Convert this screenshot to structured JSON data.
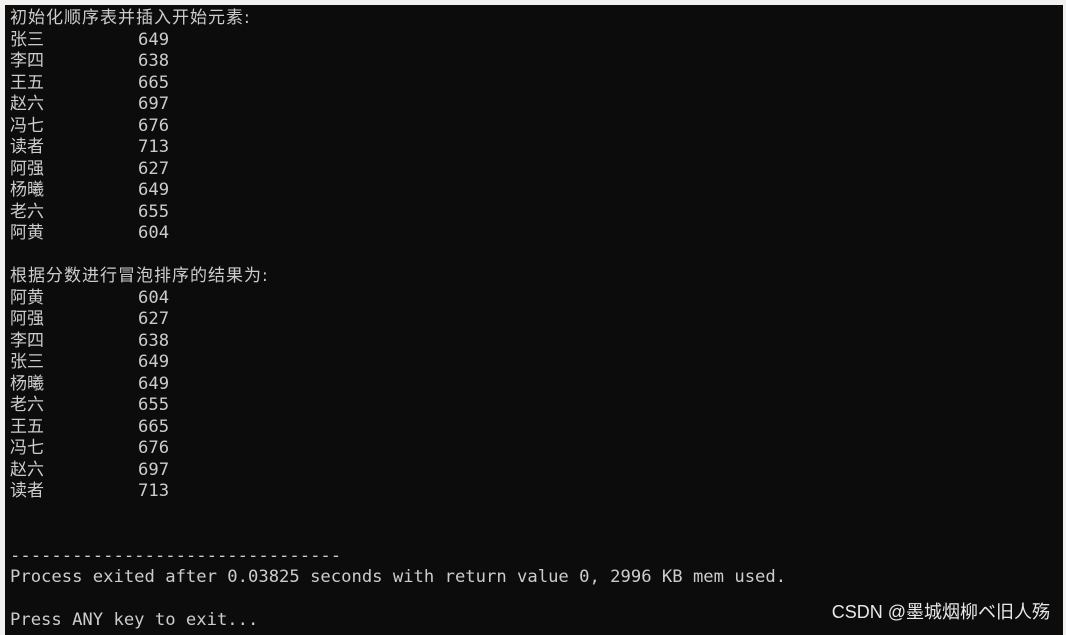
{
  "console": {
    "heading_initial": "初始化顺序表并插入开始元素:",
    "initial_rows": [
      {
        "name": "张三",
        "score": "649"
      },
      {
        "name": "李四",
        "score": "638"
      },
      {
        "name": "王五",
        "score": "665"
      },
      {
        "name": "赵六",
        "score": "697"
      },
      {
        "name": "冯七",
        "score": "676"
      },
      {
        "name": "读者",
        "score": "713"
      },
      {
        "name": "阿强",
        "score": "627"
      },
      {
        "name": "杨曦",
        "score": "649"
      },
      {
        "name": "老六",
        "score": "655"
      },
      {
        "name": "阿黄",
        "score": "604"
      }
    ],
    "heading_sorted": "根据分数进行冒泡排序的结果为:",
    "sorted_rows": [
      {
        "name": "阿黄",
        "score": "604"
      },
      {
        "name": "阿强",
        "score": "627"
      },
      {
        "name": "李四",
        "score": "638"
      },
      {
        "name": "张三",
        "score": "649"
      },
      {
        "name": "杨曦",
        "score": "649"
      },
      {
        "name": "老六",
        "score": "655"
      },
      {
        "name": "王五",
        "score": "665"
      },
      {
        "name": "冯七",
        "score": "676"
      },
      {
        "name": "赵六",
        "score": "697"
      },
      {
        "name": "读者",
        "score": "713"
      }
    ],
    "separator": "--------------------------------",
    "process_line": "Process exited after 0.03825 seconds with return value 0, 2996 KB mem used.",
    "press_line": "Press ANY key to exit..."
  },
  "watermark": "CSDN @墨城烟柳ベ旧人殇",
  "colors": {
    "background": "#0c0c0c",
    "text": "#cccccc"
  }
}
